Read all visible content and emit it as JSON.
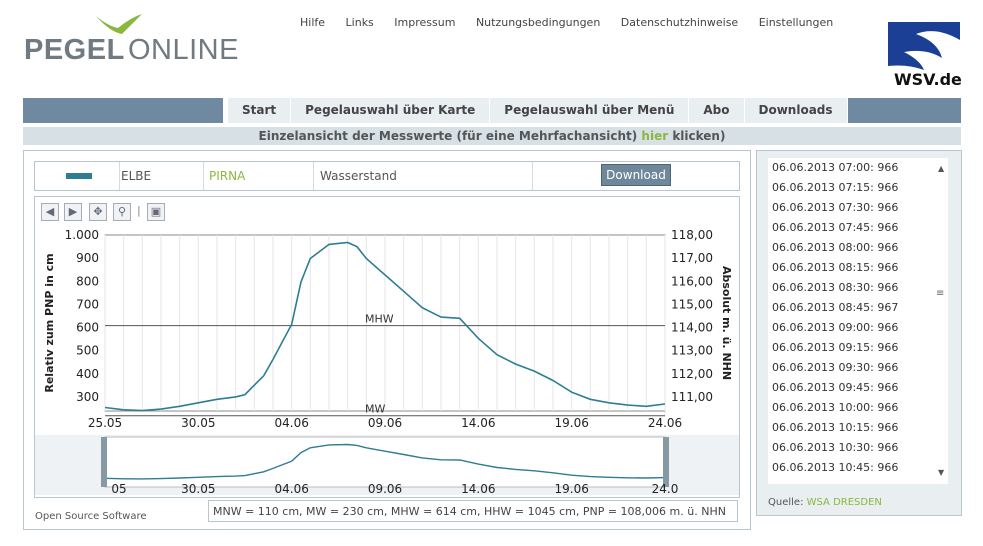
{
  "logo": {
    "pegel": "PEGEL",
    "online": "ONLINE"
  },
  "topnav": [
    "Hilfe",
    "Links",
    "Impressum",
    "Nutzungsbedingungen",
    "Datenschutzhinweise",
    "Einstellungen"
  ],
  "wsv_label": "WSV.de",
  "mainnav": [
    "Start",
    "Pegelauswahl über Karte",
    "Pegelauswahl über Menü",
    "Abo",
    "Downloads"
  ],
  "subheader": {
    "before": "Einzelansicht der Messwerte (für eine Mehrfachansicht)",
    "link": "hier",
    "after": "klicken)"
  },
  "info": {
    "river": "ELBE",
    "station": "PIRNA",
    "parameter": "Wasserstand",
    "download": "Download"
  },
  "colors": {
    "series": "#2e7d93",
    "accent": "#8ab83e",
    "nav": "#6f8aa0"
  },
  "chart_data": {
    "type": "line",
    "ylabel": "Relativ zum PNP in cm",
    "y2label": "Absolut m. ü. NHN",
    "ylim": [
      250,
      1000
    ],
    "yticks": [
      "1.000",
      "900",
      "800",
      "700",
      "600",
      "500",
      "400",
      "300"
    ],
    "y2ticks": [
      "118,00",
      "117,00",
      "116,00",
      "115,00",
      "114,00",
      "113,00",
      "112,00",
      "111,00"
    ],
    "xticks": [
      "25.05",
      "30.05",
      "04.06",
      "09.06",
      "14.06",
      "19.06",
      "24.06"
    ],
    "overview_xticks": [
      "05",
      "30.05",
      "04.06",
      "09.06",
      "14.06",
      "19.06",
      "24.0"
    ],
    "ref_lines": [
      {
        "label": "MHW",
        "value": 614
      },
      {
        "label": "MW",
        "value": 230
      }
    ],
    "x": [
      0,
      1,
      2,
      3,
      4,
      5,
      6,
      7,
      7.5,
      8,
      8.5,
      9,
      10,
      10.5,
      11,
      12,
      13,
      13.5,
      14,
      15,
      16,
      17,
      18,
      19,
      20,
      21,
      22,
      23,
      24,
      25,
      26,
      27,
      28,
      29,
      30
    ],
    "values": [
      265,
      255,
      252,
      258,
      270,
      285,
      300,
      310,
      320,
      360,
      400,
      470,
      620,
      800,
      900,
      960,
      968,
      950,
      900,
      830,
      760,
      690,
      650,
      645,
      560,
      490,
      450,
      420,
      380,
      330,
      300,
      285,
      275,
      270,
      280
    ]
  },
  "footnote": "MNW = 110 cm, MW = 230 cm, MHW = 614 cm, HHW = 1045 cm, PNP = 108,006 m. ü. NHN",
  "oss": "Open Source Software",
  "readings": [
    "06.06.2013 07:00: 966",
    "06.06.2013 07:15: 966",
    "06.06.2013 07:30: 966",
    "06.06.2013 07:45: 966",
    "06.06.2013 08:00: 966",
    "06.06.2013 08:15: 966",
    "06.06.2013 08:30: 966",
    "06.06.2013 08:45: 967",
    "06.06.2013 09:00: 966",
    "06.06.2013 09:15: 966",
    "06.06.2013 09:30: 966",
    "06.06.2013 09:45: 966",
    "06.06.2013 10:00: 966",
    "06.06.2013 10:15: 966",
    "06.06.2013 10:30: 966",
    "06.06.2013 10:45: 966"
  ],
  "quelle": {
    "label": "Quelle:",
    "value": "WSA DRESDEN"
  }
}
